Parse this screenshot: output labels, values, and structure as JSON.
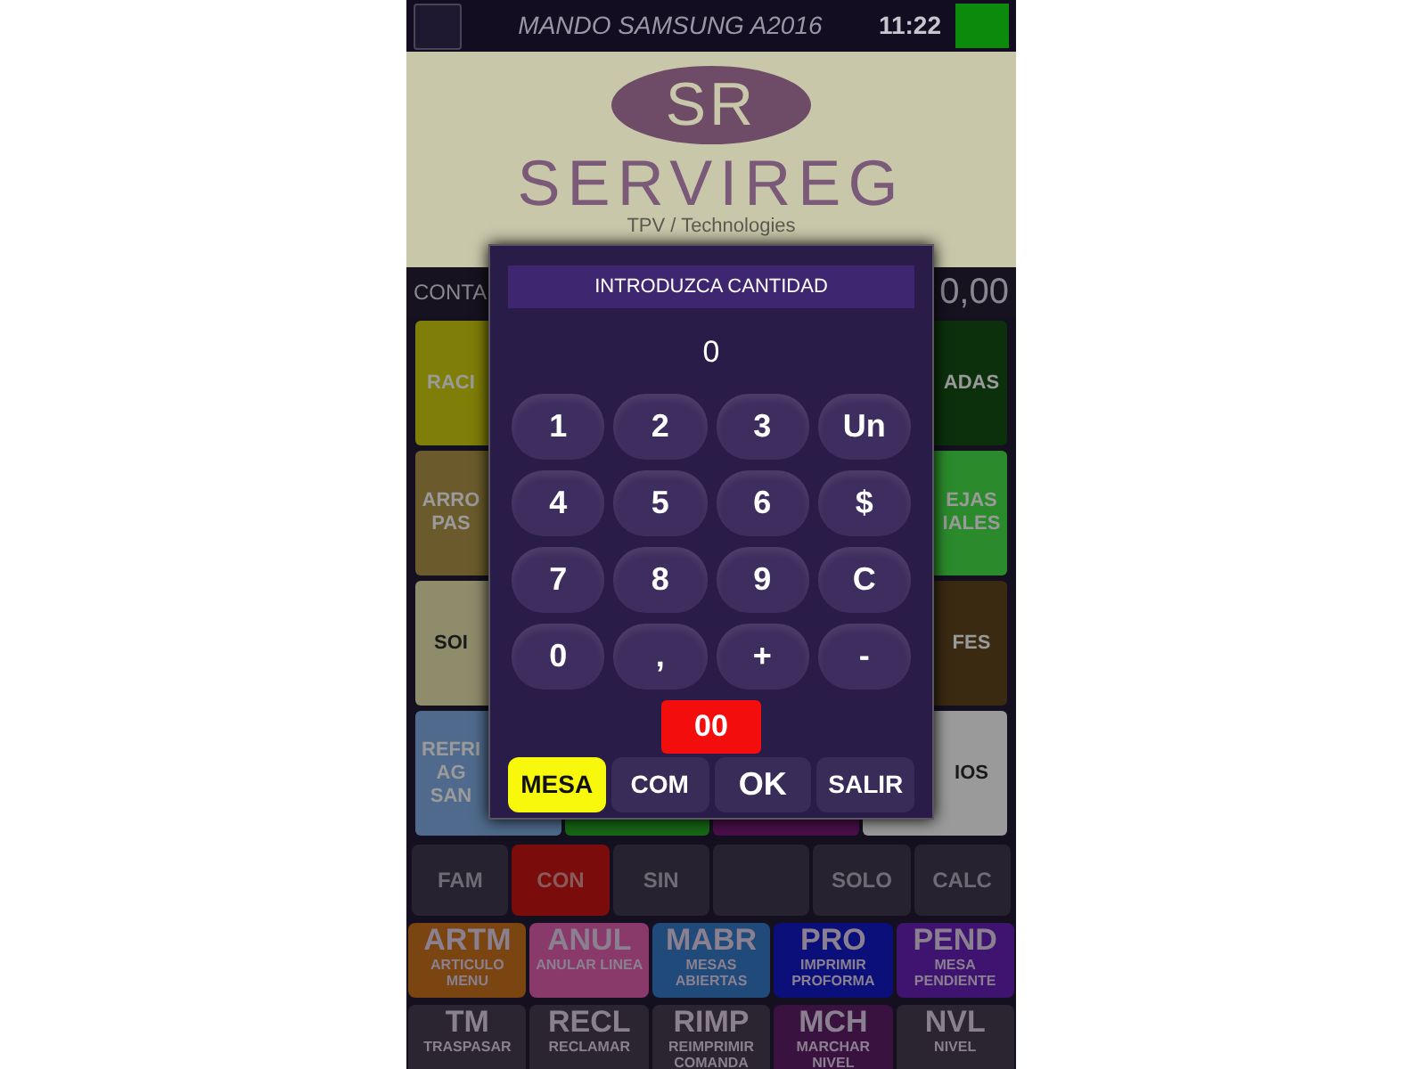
{
  "header": {
    "title": "MANDO SAMSUNG A2016",
    "time": "11:22"
  },
  "logo": {
    "monogram": "SR",
    "name": "SERVIREG",
    "tagline": "TPV / Technologies"
  },
  "summary": {
    "label": "CONTA",
    "total": "0,00"
  },
  "category_columns": [
    {
      "kind": "left",
      "tiles": [
        {
          "label": "RACI",
          "color": "#7f7e08"
        },
        {
          "label": "ARRO PAS",
          "color": "#6b5b2c"
        },
        {
          "label": "SOI",
          "color": "#8f8c6c"
        },
        {
          "label": "REFRI AG SAN",
          "color": "#4f6a8c"
        }
      ]
    },
    {
      "kind": "middle",
      "tiles": [
        {
          "color": "#166816"
        }
      ]
    },
    {
      "kind": "middle",
      "tiles": [
        {
          "color": "#4a0f4a"
        }
      ]
    },
    {
      "kind": "right",
      "tiles": [
        {
          "label": "ADAS",
          "color": "#0b300b"
        },
        {
          "label": "EJAS IALES",
          "color": "#2b8a2b"
        },
        {
          "label": "FES",
          "color": "#3a2a12"
        },
        {
          "label": "IOS",
          "color": "#9a9a9a"
        }
      ]
    }
  ],
  "function_buttons": [
    {
      "label": "FAM",
      "selected": false
    },
    {
      "label": "CON",
      "selected": true
    },
    {
      "label": "SIN",
      "selected": false
    },
    {
      "selected": false
    },
    {
      "label": "SOLO",
      "selected": false
    },
    {
      "label": "CALC",
      "selected": false
    }
  ],
  "action_rows": [
    [
      {
        "code": "ARTM",
        "label": "ARTICULO MENU",
        "color": "#7a4510"
      },
      {
        "code": "ANUL",
        "label": "ANULAR LINEA",
        "color": "#8a3a6a"
      },
      {
        "code": "MABR",
        "label": "MESAS ABIERTAS",
        "color": "#1f4a7a"
      },
      {
        "code": "PRO",
        "label": "IMPRIMIR PROFORMA",
        "color": "#0b0f7a"
      },
      {
        "code": "PEND",
        "label": "MESA PENDIENTE",
        "color": "#3f1470"
      }
    ],
    [
      {
        "code": "TM",
        "label": "TRASPASAR",
        "color": "#2a2530"
      },
      {
        "code": "RECL",
        "label": "RECLAMAR",
        "color": "#2a2530"
      },
      {
        "code": "RIMP",
        "label": "REIMPRIMIR COMANDA",
        "color": "#2a2530"
      },
      {
        "code": "MCH",
        "label": "MARCHAR NIVEL",
        "color": "#3a1240"
      },
      {
        "code": "NVL",
        "label": "NIVEL",
        "color": "#2a2530"
      }
    ]
  ],
  "dialog": {
    "title": "INTRODUZCA CANTIDAD",
    "display": "0",
    "keys": [
      "1",
      "2",
      "3",
      "Un",
      "4",
      "5",
      "6",
      "$",
      "7",
      "8",
      "9",
      "C",
      "0",
      ",",
      "+",
      "-"
    ],
    "double_zero": "00",
    "modes": [
      {
        "label": "MESA",
        "selected": true
      },
      {
        "label": "COM",
        "selected": false
      },
      {
        "label": "OK",
        "selected": false
      },
      {
        "label": "SALIR",
        "selected": false
      }
    ]
  }
}
